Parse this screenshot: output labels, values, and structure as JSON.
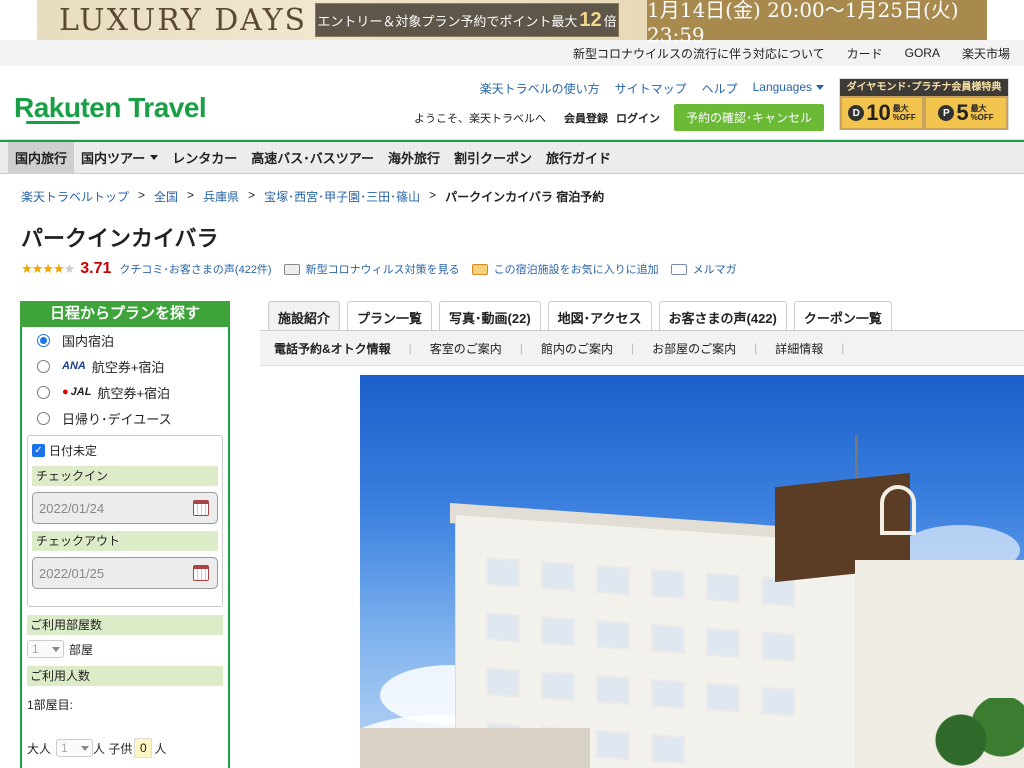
{
  "banner": {
    "title": "LUXURY DAYS",
    "middle_pre": "エントリー＆対象プラン予約でポイント最大",
    "middle_num": "12",
    "middle_post": "倍",
    "period": "1月14日(金) 20:00～1月25日(火) 23:59"
  },
  "topbar": {
    "links": [
      "新型コロナウイルスの流行に伴う対応について",
      "カード",
      "GORA",
      "楽天市場"
    ]
  },
  "header": {
    "logo": "Rakuten Travel",
    "links": [
      "楽天トラベルの使い方",
      "サイトマップ",
      "ヘルプ",
      "Languages"
    ],
    "welcome": "ようこそ、楽天トラベルへ",
    "register": "会員登録",
    "login": "ログイン",
    "reserve_button": "予約の確認･キャンセル",
    "promo": {
      "title": "ダイヤモンド･プラチナ会員様特典",
      "d_value": "10",
      "d_badge": "D",
      "p_value": "5",
      "p_badge": "P",
      "unit_top": "最大",
      "unit_bottom": "%OFF"
    }
  },
  "nav": {
    "items": [
      "国内旅行",
      "国内ツアー",
      "レンタカー",
      "高速バス･バスツアー",
      "海外旅行",
      "割引クーポン",
      "旅行ガイド"
    ]
  },
  "breadcrumb": {
    "items": [
      "楽天トラベルトップ",
      "全国",
      "兵庫県",
      "宝塚･西宮･甲子園･三田･篠山"
    ],
    "current": "パークインカイバラ 宿泊予約",
    "sep": ">"
  },
  "hotel": {
    "name": "パークインカイバラ",
    "rating": "3.71",
    "stars": "★★★★",
    "stars_off": "★",
    "reviews_link": "クチコミ･お客さまの声(422件)",
    "covid_link": "新型コロナウィルス対策を見る",
    "favorite_link": "この宿泊施設をお気に入りに追加",
    "mail_link": "メルマガ"
  },
  "sidebar": {
    "title": "日程からプランを探す",
    "options": [
      {
        "label": "国内宿泊",
        "airline": ""
      },
      {
        "label": "航空券+宿泊",
        "airline": "ANA"
      },
      {
        "label": "航空券+宿泊",
        "airline": "JAL"
      },
      {
        "label": "日帰り･デイユース",
        "airline": ""
      }
    ],
    "undecided": "日付未定",
    "checkin_label": "チェックイン",
    "checkin_value": "2022/01/24",
    "checkout_label": "チェックアウト",
    "checkout_value": "2022/01/25",
    "rooms_label": "ご利用部屋数",
    "rooms_value": "1",
    "rooms_unit": "部屋",
    "people_label": "ご利用人数",
    "room1_label": "1部屋目:",
    "adult_label": "大人",
    "adult_value": "1",
    "adult_unit": "人 子供",
    "child_value": "0",
    "child_unit": "人"
  },
  "tabs": {
    "items": [
      "施設紹介",
      "プラン一覧",
      "写真･動画(22)",
      "地図･アクセス",
      "お客さまの声(422)",
      "クーポン一覧"
    ]
  },
  "subnav": {
    "items": [
      "電話予約&オトク情報",
      "客室のご案内",
      "館内のご案内",
      "お部屋のご案内",
      "詳細情報"
    ]
  },
  "colors": {
    "brand_green": "#19a047",
    "link_blue": "#2a64a8",
    "rating_red": "#c70000"
  }
}
